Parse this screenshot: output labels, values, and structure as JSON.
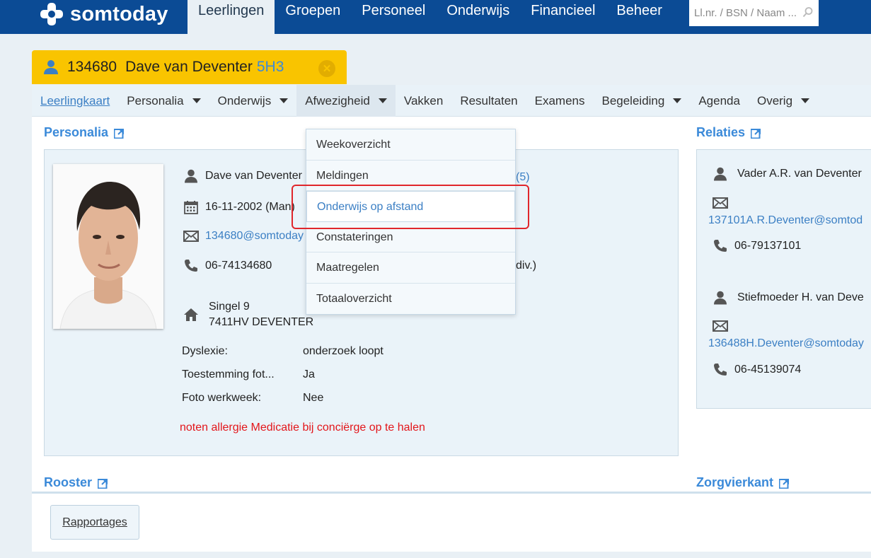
{
  "header": {
    "logo_text": "somtoday",
    "nav": [
      "Leerlingen",
      "Groepen",
      "Personeel",
      "Onderwijs",
      "Financieel",
      "Beheer"
    ],
    "active_nav": "Leerlingen",
    "search_placeholder": "Ll.nr. / BSN / Naam ..."
  },
  "student_tab": {
    "number": "134680",
    "name": "Dave van Deventer",
    "class": "5H3"
  },
  "subnav": {
    "items": [
      {
        "label": "Leerlingkaart",
        "dropdown": false
      },
      {
        "label": "Personalia",
        "dropdown": true
      },
      {
        "label": "Onderwijs",
        "dropdown": true
      },
      {
        "label": "Afwezigheid",
        "dropdown": true
      },
      {
        "label": "Vakken",
        "dropdown": false
      },
      {
        "label": "Resultaten",
        "dropdown": false
      },
      {
        "label": "Examens",
        "dropdown": false
      },
      {
        "label": "Begeleiding",
        "dropdown": true
      },
      {
        "label": "Agenda",
        "dropdown": false
      },
      {
        "label": "Overig",
        "dropdown": true
      }
    ]
  },
  "dropdown": {
    "items": [
      "Weekoverzicht",
      "Meldingen",
      "Onderwijs op afstand",
      "Constateringen",
      "Maatregelen",
      "Totaaloverzicht"
    ],
    "selected": "Onderwijs op afstand"
  },
  "personalia": {
    "title": "Personalia",
    "name": "Dave van Deventer",
    "name_suffix": "(5)",
    "birthdate": "16-11-2002 (Man)",
    "email": "134680@somtoday",
    "phone": "06-74134680",
    "phone_suffix": "div.)",
    "street": "Singel 9",
    "city": "7411HV DEVENTER",
    "fields": [
      {
        "label": "Dyslexie:",
        "value": "onderzoek loopt"
      },
      {
        "label": "Toestemming fot...",
        "value": "Ja"
      },
      {
        "label": "Foto werkweek:",
        "value": "Nee"
      }
    ],
    "note": "noten allergie Medicatie bij conciërge op te halen"
  },
  "relaties": {
    "title": "Relaties",
    "items": [
      {
        "name": "Vader A.R. van Deventer",
        "email": "137101A.R.Deventer@somtod",
        "phone": "06-79137101"
      },
      {
        "name": "Stiefmoeder H. van Deve",
        "email": "136488H.Deventer@somtoday",
        "phone": "06-45139074"
      }
    ]
  },
  "sections": {
    "rooster": "Rooster",
    "zorgvierkant": "Zorgvierkant"
  },
  "buttons": {
    "rapportages": "Rapportages"
  },
  "colors": {
    "topbar": "#0b4b95",
    "student_tab": "#f9c400",
    "link": "#3b7fc4",
    "highlight": "#e0262b",
    "note": "#e3161b"
  }
}
